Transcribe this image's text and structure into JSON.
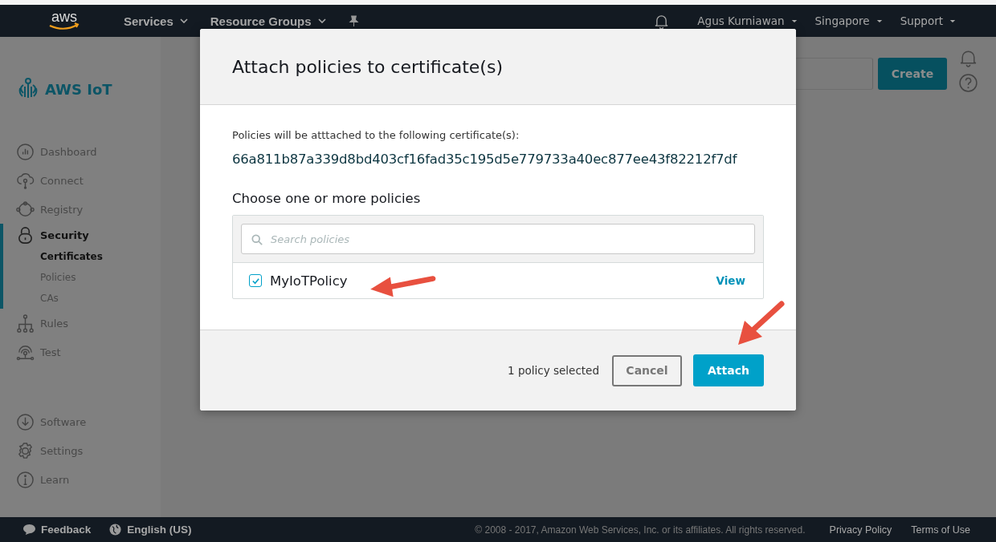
{
  "nav": {
    "logo": "aws",
    "menus": [
      {
        "label": "Services"
      },
      {
        "label": "Resource Groups"
      }
    ],
    "account_menus": [
      {
        "label": "Agus Kurniawan"
      },
      {
        "label": "Singapore"
      },
      {
        "label": "Support"
      }
    ]
  },
  "sidebar": {
    "title": "AWS IoT",
    "items": [
      {
        "label": "Dashboard",
        "kind": "dashboard",
        "selected": false
      },
      {
        "label": "Connect",
        "kind": "connect",
        "selected": false
      },
      {
        "label": "Registry",
        "kind": "registry",
        "selected": false
      },
      {
        "label": "Security",
        "kind": "security",
        "selected": true,
        "children": [
          {
            "label": "Certificates",
            "selected": true
          },
          {
            "label": "Policies",
            "selected": false
          },
          {
            "label": "CAs",
            "selected": false
          }
        ]
      },
      {
        "label": "Rules",
        "kind": "rules",
        "selected": false
      },
      {
        "label": "Test",
        "kind": "test",
        "selected": false
      }
    ],
    "bottom_items": [
      {
        "label": "Software",
        "kind": "software",
        "selected": false
      },
      {
        "label": "Settings",
        "kind": "settings",
        "selected": false
      },
      {
        "label": "Learn",
        "kind": "learn",
        "selected": false
      }
    ]
  },
  "page": {
    "create_button": "Create"
  },
  "modal": {
    "title": "Attach policies to certificate(s)",
    "intro": "Policies will be atttached to the following certificate(s):",
    "certificate_id": "66a811b87a339d8bd403cf16fad35c195d5e779733a40ec877ee43f82212f7df",
    "choose_label": "Choose one or more policies",
    "search": {
      "placeholder": "Search policies"
    },
    "policies": [
      {
        "name": "MyIoTPolicy",
        "checked": true,
        "link": "View"
      }
    ],
    "selection_count": "1 policy selected",
    "cancel_button": "Cancel",
    "attach_button": "Attach"
  },
  "footer": {
    "feedback": "Feedback",
    "language": "English (US)",
    "copyright": "© 2008 - 2017, Amazon Web Services, Inc. or its affiliates. All rights reserved.",
    "links": [
      "Privacy Policy",
      "Terms of Use"
    ]
  }
}
